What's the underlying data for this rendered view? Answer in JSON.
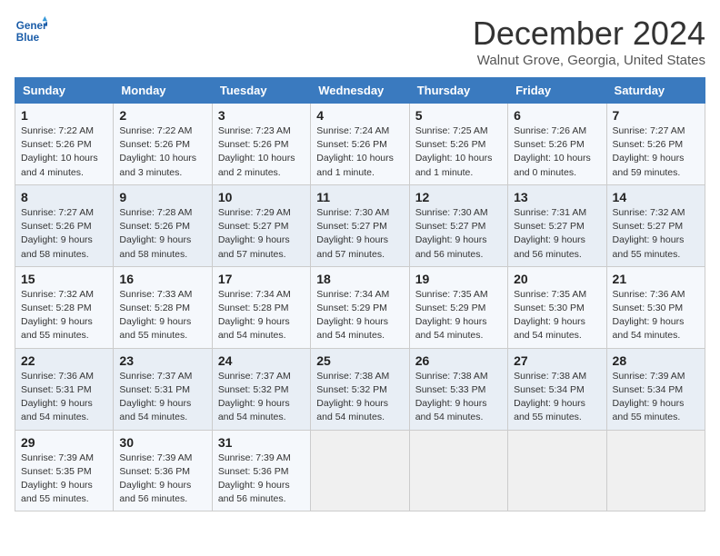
{
  "header": {
    "logo_line1": "General",
    "logo_line2": "Blue",
    "title": "December 2024",
    "location": "Walnut Grove, Georgia, United States"
  },
  "days_of_week": [
    "Sunday",
    "Monday",
    "Tuesday",
    "Wednesday",
    "Thursday",
    "Friday",
    "Saturday"
  ],
  "weeks": [
    [
      {
        "day": "1",
        "sunrise": "7:22 AM",
        "sunset": "5:26 PM",
        "daylight": "10 hours and 4 minutes."
      },
      {
        "day": "2",
        "sunrise": "7:22 AM",
        "sunset": "5:26 PM",
        "daylight": "10 hours and 3 minutes."
      },
      {
        "day": "3",
        "sunrise": "7:23 AM",
        "sunset": "5:26 PM",
        "daylight": "10 hours and 2 minutes."
      },
      {
        "day": "4",
        "sunrise": "7:24 AM",
        "sunset": "5:26 PM",
        "daylight": "10 hours and 1 minute."
      },
      {
        "day": "5",
        "sunrise": "7:25 AM",
        "sunset": "5:26 PM",
        "daylight": "10 hours and 1 minute."
      },
      {
        "day": "6",
        "sunrise": "7:26 AM",
        "sunset": "5:26 PM",
        "daylight": "10 hours and 0 minutes."
      },
      {
        "day": "7",
        "sunrise": "7:27 AM",
        "sunset": "5:26 PM",
        "daylight": "9 hours and 59 minutes."
      }
    ],
    [
      {
        "day": "8",
        "sunrise": "7:27 AM",
        "sunset": "5:26 PM",
        "daylight": "9 hours and 58 minutes."
      },
      {
        "day": "9",
        "sunrise": "7:28 AM",
        "sunset": "5:26 PM",
        "daylight": "9 hours and 58 minutes."
      },
      {
        "day": "10",
        "sunrise": "7:29 AM",
        "sunset": "5:27 PM",
        "daylight": "9 hours and 57 minutes."
      },
      {
        "day": "11",
        "sunrise": "7:30 AM",
        "sunset": "5:27 PM",
        "daylight": "9 hours and 57 minutes."
      },
      {
        "day": "12",
        "sunrise": "7:30 AM",
        "sunset": "5:27 PM",
        "daylight": "9 hours and 56 minutes."
      },
      {
        "day": "13",
        "sunrise": "7:31 AM",
        "sunset": "5:27 PM",
        "daylight": "9 hours and 56 minutes."
      },
      {
        "day": "14",
        "sunrise": "7:32 AM",
        "sunset": "5:27 PM",
        "daylight": "9 hours and 55 minutes."
      }
    ],
    [
      {
        "day": "15",
        "sunrise": "7:32 AM",
        "sunset": "5:28 PM",
        "daylight": "9 hours and 55 minutes."
      },
      {
        "day": "16",
        "sunrise": "7:33 AM",
        "sunset": "5:28 PM",
        "daylight": "9 hours and 55 minutes."
      },
      {
        "day": "17",
        "sunrise": "7:34 AM",
        "sunset": "5:28 PM",
        "daylight": "9 hours and 54 minutes."
      },
      {
        "day": "18",
        "sunrise": "7:34 AM",
        "sunset": "5:29 PM",
        "daylight": "9 hours and 54 minutes."
      },
      {
        "day": "19",
        "sunrise": "7:35 AM",
        "sunset": "5:29 PM",
        "daylight": "9 hours and 54 minutes."
      },
      {
        "day": "20",
        "sunrise": "7:35 AM",
        "sunset": "5:30 PM",
        "daylight": "9 hours and 54 minutes."
      },
      {
        "day": "21",
        "sunrise": "7:36 AM",
        "sunset": "5:30 PM",
        "daylight": "9 hours and 54 minutes."
      }
    ],
    [
      {
        "day": "22",
        "sunrise": "7:36 AM",
        "sunset": "5:31 PM",
        "daylight": "9 hours and 54 minutes."
      },
      {
        "day": "23",
        "sunrise": "7:37 AM",
        "sunset": "5:31 PM",
        "daylight": "9 hours and 54 minutes."
      },
      {
        "day": "24",
        "sunrise": "7:37 AM",
        "sunset": "5:32 PM",
        "daylight": "9 hours and 54 minutes."
      },
      {
        "day": "25",
        "sunrise": "7:38 AM",
        "sunset": "5:32 PM",
        "daylight": "9 hours and 54 minutes."
      },
      {
        "day": "26",
        "sunrise": "7:38 AM",
        "sunset": "5:33 PM",
        "daylight": "9 hours and 54 minutes."
      },
      {
        "day": "27",
        "sunrise": "7:38 AM",
        "sunset": "5:34 PM",
        "daylight": "9 hours and 55 minutes."
      },
      {
        "day": "28",
        "sunrise": "7:39 AM",
        "sunset": "5:34 PM",
        "daylight": "9 hours and 55 minutes."
      }
    ],
    [
      {
        "day": "29",
        "sunrise": "7:39 AM",
        "sunset": "5:35 PM",
        "daylight": "9 hours and 55 minutes."
      },
      {
        "day": "30",
        "sunrise": "7:39 AM",
        "sunset": "5:36 PM",
        "daylight": "9 hours and 56 minutes."
      },
      {
        "day": "31",
        "sunrise": "7:39 AM",
        "sunset": "5:36 PM",
        "daylight": "9 hours and 56 minutes."
      },
      null,
      null,
      null,
      null
    ]
  ]
}
